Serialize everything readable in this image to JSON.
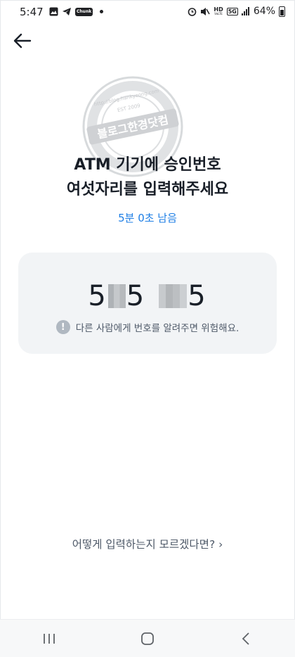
{
  "status_bar": {
    "time": "5:47",
    "app_badge": "Chunk",
    "hd_label": "HD",
    "volte_label": "VoLTE",
    "network": "5G",
    "battery": "64%",
    "icons": [
      "gallery-icon",
      "telegram-icon",
      "app-badge-icon",
      "notification-dot",
      "alarm-icon",
      "mute-icon",
      "hd-voice-icon",
      "5g-icon",
      "signal-icon",
      "battery-icon"
    ]
  },
  "header": {
    "back_icon": "arrow-left-icon"
  },
  "watermark": {
    "text": "블로그한경닷컴",
    "url": "http://blog.hankyeong.com",
    "est": "EST 2009"
  },
  "title": {
    "line1": "ATM 기기에 승인번호",
    "line2": "여섯자리를 입력해주세요"
  },
  "timer": "5분 0초 남음",
  "code_card": {
    "digit1": "5",
    "digit3": "5",
    "digit6": "5",
    "warning_icon": "!",
    "warning": "다른 사람에게 번호를 알려주면 위험해요."
  },
  "help_link": "어떻게 입력하는지 모르겠다면? ›",
  "nav_bar": {
    "icons": [
      "recent-apps-icon",
      "home-icon",
      "back-nav-icon"
    ]
  },
  "colors": {
    "accent": "#1d7ee5",
    "card_bg": "#f2f4f6",
    "text": "#191f28",
    "muted": "#4e5968"
  }
}
